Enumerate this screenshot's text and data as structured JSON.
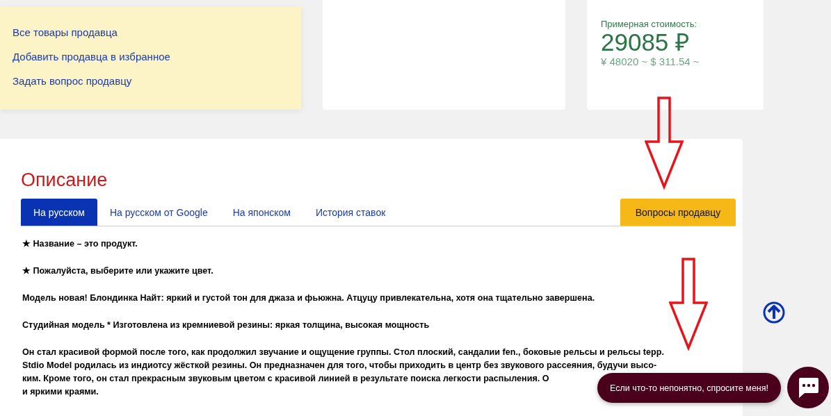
{
  "seller_links": [
    "Все товары продавца",
    "Добавить продавца в избранное",
    "Задать вопрос продавцу"
  ],
  "price": {
    "label": "Примерная стоимость:",
    "amount": "29085 ₽",
    "other_currencies": "¥ 48020 ~ $ 311.54 ~"
  },
  "description": {
    "title": "Описание",
    "tabs": [
      {
        "label": "На русском",
        "selected": true
      },
      {
        "label": "На русском от Google",
        "selected": false
      },
      {
        "label": "На японском",
        "selected": false
      },
      {
        "label": "История ставок",
        "selected": false
      }
    ],
    "ask_button": "Вопросы продавцу",
    "paragraphs": [
      {
        "lines": [
          "★ Название – это продукт."
        ]
      },
      {
        "lines": [
          "★ Пожалуйста, выберите или укажите цвет."
        ]
      },
      {
        "lines": [
          "Модель новая! Блондинка Найт: яркий и густой тон для джаза и фьюжна. Атцуцу привлекательна, хотя она тщательно завершена."
        ]
      },
      {
        "lines": [
          "Студийная модель * Изготовлена из кремниевой резины: яркая толщина, высокая мощность"
        ]
      },
      {
        "lines": [
          "Он стал красивой формой после того, как продолжил звучание и ощущение группы. Стол плоский, сандалии fen., боковые рельсы и рельсы tepp.",
          "Stdio Model родилась из индиотсу жёсткой резины. Он предназначен для того, чтобы приходить в центр без звукового рассеяния, будучи высо-",
          "ким. Кроме того, он стал прекрасным звуковым цветом с красивой линией в результате поиска легкости распыления. О",
          "и яркими краями."
        ]
      }
    ]
  },
  "chat": {
    "prompt": "Если что-то непонятно, спросите меня!"
  }
}
